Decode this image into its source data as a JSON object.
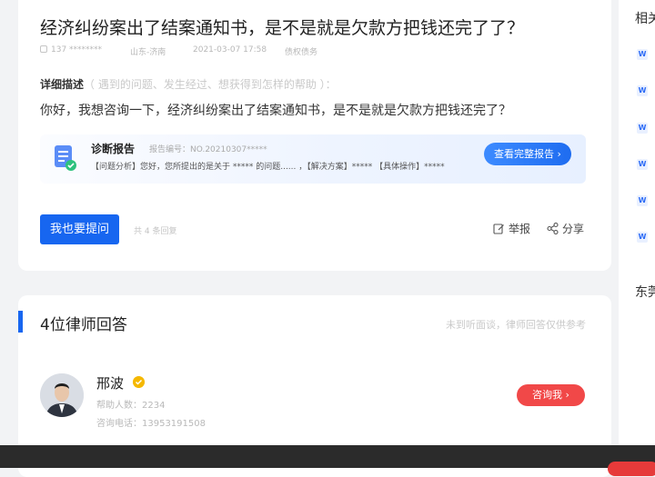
{
  "question": {
    "title": "经济纠纷案出了结案通知书，是不是就是欠款方把钱还完了了？",
    "meta": {
      "user": "137 ********",
      "location": "山东-济南",
      "date": "2021-03-07 17:58",
      "category": "债权债务"
    },
    "description_label": "详细描述",
    "description_hint": "（ 遇到的问题、发生经过、想获得到怎样的帮助 ）：",
    "body": "你好，我想咨询一下，经济纠纷案出了结案通知书，是不是就是欠款方把钱还完了？",
    "report": {
      "title": "诊断报告",
      "number": "报告编号：NO.20210307*****",
      "summary": "【问题分析】您好，您所提出的是关于 ***** 的问题...... ，【解决方案】***** 【具体操作】*****",
      "button_label": "查看完整报告 ›"
    },
    "ask_button": "我也要提问",
    "reply_count": "共 4 条回复",
    "report_action": "举报",
    "share_action": "分享"
  },
  "answers": {
    "title": "4位律师回答",
    "note": "未到听面谈，律师回答仅供参考",
    "lawyer": {
      "name": "邢波",
      "helped": "帮助人数：2234",
      "phone": "咨询电话：13953191508",
      "consult_button": "咨询我 ›"
    }
  },
  "sidebar": {
    "title": "相关",
    "title2": "东莞",
    "doc_badge": "W"
  },
  "colors": {
    "primary": "#1766f0",
    "consult": "#f14848",
    "verified": "#f5b800"
  }
}
